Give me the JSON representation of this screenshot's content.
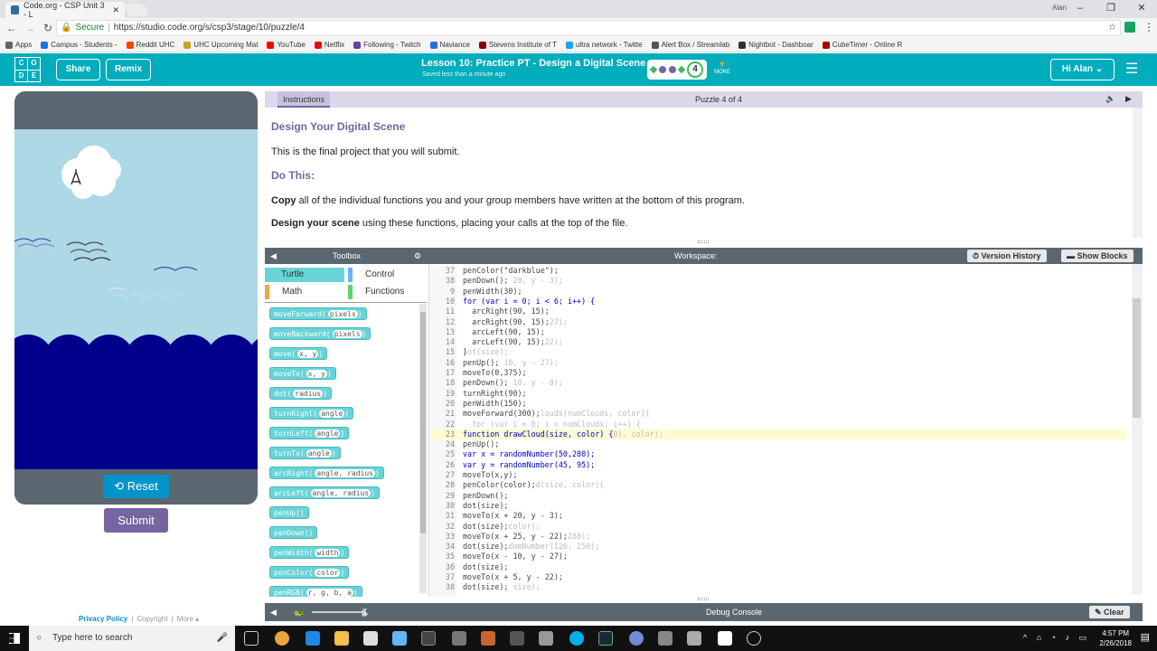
{
  "browser": {
    "tab_title": "Code.org - CSP Unit 3 - L",
    "user_label": "Alan",
    "secure_label": "Secure",
    "url": "https://studio.code.org/s/csp3/stage/10/puzzle/4",
    "bookmarks": [
      "Apps",
      "Campus - Students -",
      "Reddit UHC",
      "UHC Upcoming Mat",
      "YouTube",
      "Netflix",
      "Following - Twitch",
      "Naviance",
      "Stevens Institute of T",
      "ultra network - Twitte",
      "Alert Box / Streamlab",
      "Nightbot - Dashboar",
      "CubeTimer - Online R"
    ]
  },
  "header": {
    "logo_letters": [
      "C",
      "O",
      "D",
      "E"
    ],
    "share": "Share",
    "remix": "Remix",
    "lesson_title": "Lesson 10: Practice PT - Design a Digital Scene",
    "saved": "Saved less than a minute ago",
    "level_number": "4",
    "more": "MORE",
    "user": "Hi Alan"
  },
  "stage": {
    "reset": "Reset",
    "submit": "Submit"
  },
  "footer": {
    "privacy": "Privacy Policy",
    "copyright": "Copyright",
    "more": "More"
  },
  "instructions": {
    "tab": "Instructions",
    "puzzle": "Puzzle 4 of 4",
    "title": "Design Your Digital Scene",
    "p1": "This is the final project that you will submit.",
    "do_this": "Do This:",
    "copy_bold": "Copy",
    "copy_rest": " all of the individual functions you and your group members have written at the bottom of this program.",
    "design_bold": "Design your scene",
    "design_rest": " using these functions, placing your calls at the top of the file."
  },
  "toolbox": {
    "title": "Toolbox",
    "categories": [
      "Turtle",
      "Control",
      "Math",
      "Functions"
    ],
    "blocks": [
      {
        "name": "moveForward",
        "args": "pixels"
      },
      {
        "name": "moveBackward",
        "args": "pixels"
      },
      {
        "name": "move",
        "args": "x, y"
      },
      {
        "name": "moveTo",
        "args": "x, y"
      },
      {
        "name": "dot",
        "args": "radius"
      },
      {
        "name": "turnRight",
        "args": "angle"
      },
      {
        "name": "turnLeft",
        "args": "angle"
      },
      {
        "name": "turnTo",
        "args": "angle"
      },
      {
        "name": "arcRight",
        "args": "angle, radius"
      },
      {
        "name": "arcLeft",
        "args": "angle, radius"
      },
      {
        "name": "penUp",
        "args": ""
      },
      {
        "name": "penDown",
        "args": ""
      },
      {
        "name": "penWidth",
        "args": "width"
      },
      {
        "name": "penColor",
        "args": "color"
      },
      {
        "name": "penRGB",
        "args": "r, g, b, a"
      }
    ]
  },
  "workspace": {
    "title": "Workspace:",
    "version_history": "Version History",
    "show_blocks": "Show Blocks",
    "lines": [
      {
        "n": "37",
        "t": "penColor(\"darkblue\");"
      },
      {
        "n": "38",
        "t": "penDown();",
        "g": " 20, y - 3);"
      },
      {
        "n": "9",
        "t": "penWidth(30);"
      },
      {
        "n": "10",
        "t": "for (var i = 0; i < 6; i++) {"
      },
      {
        "n": "11",
        "t": "  arcRight(90, 15);"
      },
      {
        "n": "12",
        "t": "  arcRight(90, 15);",
        "g": "27);"
      },
      {
        "n": "13",
        "t": "  arcLeft(90, 15);"
      },
      {
        "n": "14",
        "t": "  arcLeft(90, 15);",
        "g": "22);"
      },
      {
        "n": "15",
        "t": "}",
        "g": "ot(size);"
      },
      {
        "n": "16",
        "t": "penUp();",
        "g": " 10, y - 27);"
      },
      {
        "n": "17",
        "t": "moveTo(0,375);"
      },
      {
        "n": "18",
        "t": "penDown();",
        "g": " 10, y - 8);"
      },
      {
        "n": "19",
        "t": "turnRight(90);"
      },
      {
        "n": "20",
        "t": "penWidth(150);"
      },
      {
        "n": "21",
        "t": "moveForward(300);",
        "g": "louds(numClouds, color){"
      },
      {
        "n": "22",
        "t": "",
        "g": "  for (var i = 0; i < numClouds; i++) {"
      },
      {
        "n": "23",
        "t": "function drawCloud(size, color) {",
        "g": "0), color);"
      },
      {
        "n": "24",
        "t": "penUp();"
      },
      {
        "n": "25",
        "t": "var x = randomNumber(50,280);"
      },
      {
        "n": "26",
        "t": "var y = randomNumber(45, 95);"
      },
      {
        "n": "27",
        "t": "moveTo(x,y);"
      },
      {
        "n": "28",
        "t": "penColor(color);",
        "g": "d(size, color){"
      },
      {
        "n": "29",
        "t": "penDown();"
      },
      {
        "n": "30",
        "t": "dot(size);"
      },
      {
        "n": "31",
        "t": "moveTo(x + 20, y - 3);"
      },
      {
        "n": "32",
        "t": "dot(size);",
        "g": "color);"
      },
      {
        "n": "33",
        "t": "moveTo(x + 25, y - 22);",
        "g": "280);"
      },
      {
        "n": "34",
        "t": "dot(size);",
        "g": "domNumber(120, 250);"
      },
      {
        "n": "35",
        "t": "moveTo(x - 10, y - 27);"
      },
      {
        "n": "36",
        "t": "dot(size);"
      },
      {
        "n": "37",
        "t": "moveTo(x + 5, y - 22);"
      },
      {
        "n": "38",
        "t": "dot(size);",
        "g": " size);"
      }
    ]
  },
  "debug": {
    "title": "Debug Console",
    "clear": "Clear"
  },
  "taskbar": {
    "search": "Type here to search",
    "time": "4:57 PM",
    "date": "2/26/2018"
  },
  "colors": {
    "teal": "#00adbc",
    "purple": "#7665a0",
    "slate": "#5b6770",
    "sky": "#add8e6",
    "ocean": "#00008b",
    "reset_blue": "#0094ca"
  }
}
